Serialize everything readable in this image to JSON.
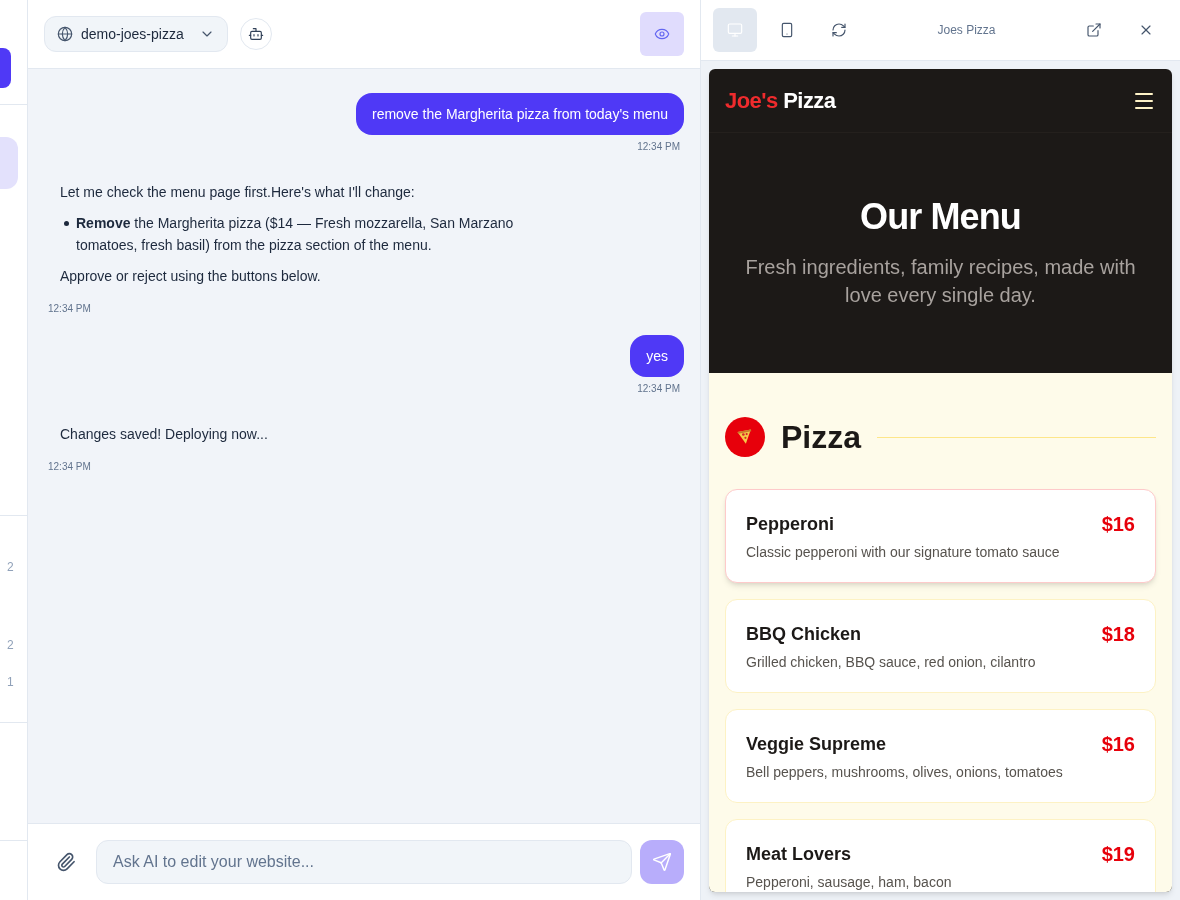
{
  "sidebar": {
    "items": [
      {
        "selected": true
      }
    ],
    "counts": [
      "2",
      "2",
      "1"
    ]
  },
  "chat": {
    "site_selector": {
      "label": "demo-joes-pizza"
    },
    "preview_toggle": {
      "on": true
    },
    "messages": [
      {
        "kind": "user",
        "text": "remove the Margherita pizza from today's menu",
        "time": "12:34 PM"
      },
      {
        "kind": "assistant",
        "blocks": [
          {
            "kind": "paragraph",
            "text": "Let me check the menu page first.Here's what I'll change:"
          },
          {
            "kind": "bullet",
            "text": "**Remove** the Margherita pizza ($14 — Fresh mozzarella, San Marzano tomatoes, fresh basil) from the pizza section of the menu."
          },
          {
            "kind": "paragraph",
            "text": "Approve or reject using the buttons below."
          }
        ],
        "time": "12:34 PM"
      },
      {
        "kind": "user",
        "text": "yes",
        "time": "12:34 PM"
      },
      {
        "kind": "assistant",
        "blocks": [
          {
            "kind": "paragraph",
            "text": "Changes saved! Deploying now..."
          }
        ],
        "time": "12:34 PM"
      }
    ],
    "composer": {
      "placeholder": "Ask AI to edit your website...",
      "send_disabled": true
    }
  },
  "preview": {
    "devices": [
      {
        "kind": "desktop",
        "selected": true
      },
      {
        "kind": "mobile",
        "selected": false
      }
    ],
    "title": "Joes Pizza",
    "site": {
      "logo": {
        "parts": [
          "Joe's",
          "Pizza"
        ]
      },
      "hero": {
        "title": "Our Menu",
        "subtitle": "Fresh ingredients, family recipes, made with love every single day."
      },
      "section": {
        "title": "Pizza",
        "items": [
          {
            "name": "Pepperoni",
            "price": "$16",
            "description": "Classic pepperoni with our signature tomato sauce",
            "highlighted": true
          },
          {
            "name": "BBQ Chicken",
            "price": "$18",
            "description": "Grilled chicken, BBQ sauce, red onion, cilantro",
            "highlighted": false
          },
          {
            "name": "Veggie Supreme",
            "price": "$16",
            "description": "Bell peppers, mushrooms, olives, onions, tomatoes",
            "highlighted": false
          },
          {
            "name": "Meat Lovers",
            "price": "$19",
            "description": "Pepperoni, sausage, ham, bacon",
            "highlighted": false
          }
        ]
      }
    }
  }
}
